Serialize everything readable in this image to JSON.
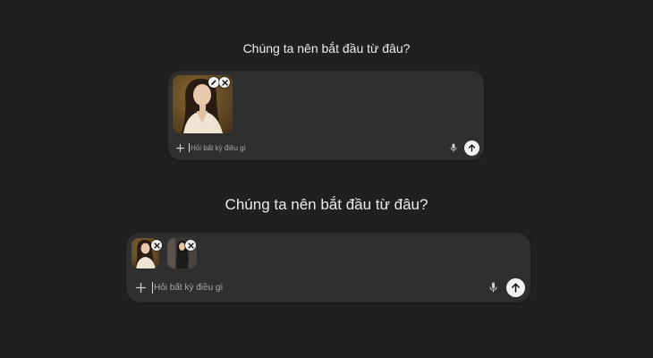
{
  "top_panel": {
    "heading": "Chúng ta nên bắt đầu từ đâu?",
    "input_placeholder": "Hỏi bất kỳ điều gì"
  },
  "bottom_panel": {
    "heading": "Chúng ta nên bắt đầu từ đâu?",
    "input_placeholder": "Hỏi bất kỳ điều gì"
  },
  "icons": {
    "plus": "plus-icon",
    "mic": "microphone-icon",
    "send": "arrow-up-icon",
    "remove": "close-icon",
    "edit": "pencil-icon"
  },
  "colors": {
    "background": "#202020",
    "composer": "#2f2f2f",
    "send_button": "#f2f2f2"
  }
}
